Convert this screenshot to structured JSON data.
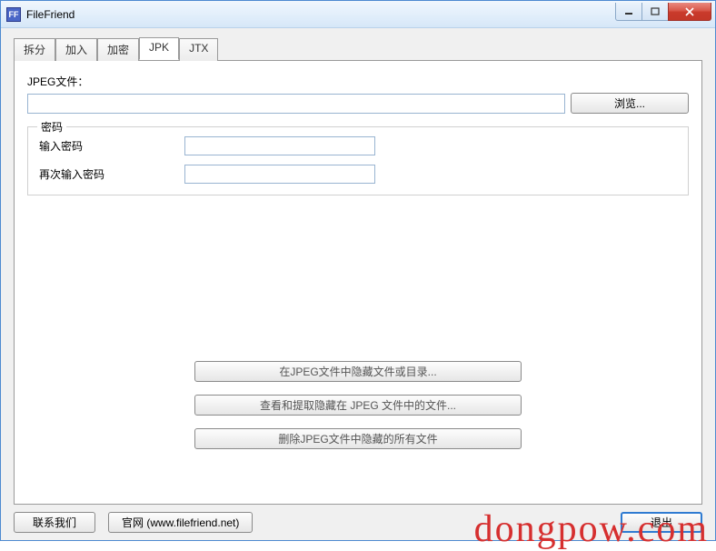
{
  "window": {
    "title": "FileFriend",
    "icon_text": "FF"
  },
  "tabs": [
    {
      "label": "拆分"
    },
    {
      "label": "加入"
    },
    {
      "label": "加密"
    },
    {
      "label": "JPK"
    },
    {
      "label": "JTX"
    }
  ],
  "jpk": {
    "file_label": "JPEG文件：",
    "file_value": "",
    "browse_label": "浏览...",
    "password_group": "密码",
    "enter_password_label": "输入密码",
    "reenter_password_label": "再次输入密码",
    "enter_password_value": "",
    "reenter_password_value": "",
    "hide_btn": "在JPEG文件中隐藏文件或目录...",
    "extract_btn": "查看和提取隐藏在 JPEG 文件中的文件...",
    "delete_btn": "删除JPEG文件中隐藏的所有文件"
  },
  "footer": {
    "contact": "联系我们",
    "website": "官网 (www.filefriend.net)",
    "exit": "退出"
  },
  "watermark": "dongpow.com"
}
